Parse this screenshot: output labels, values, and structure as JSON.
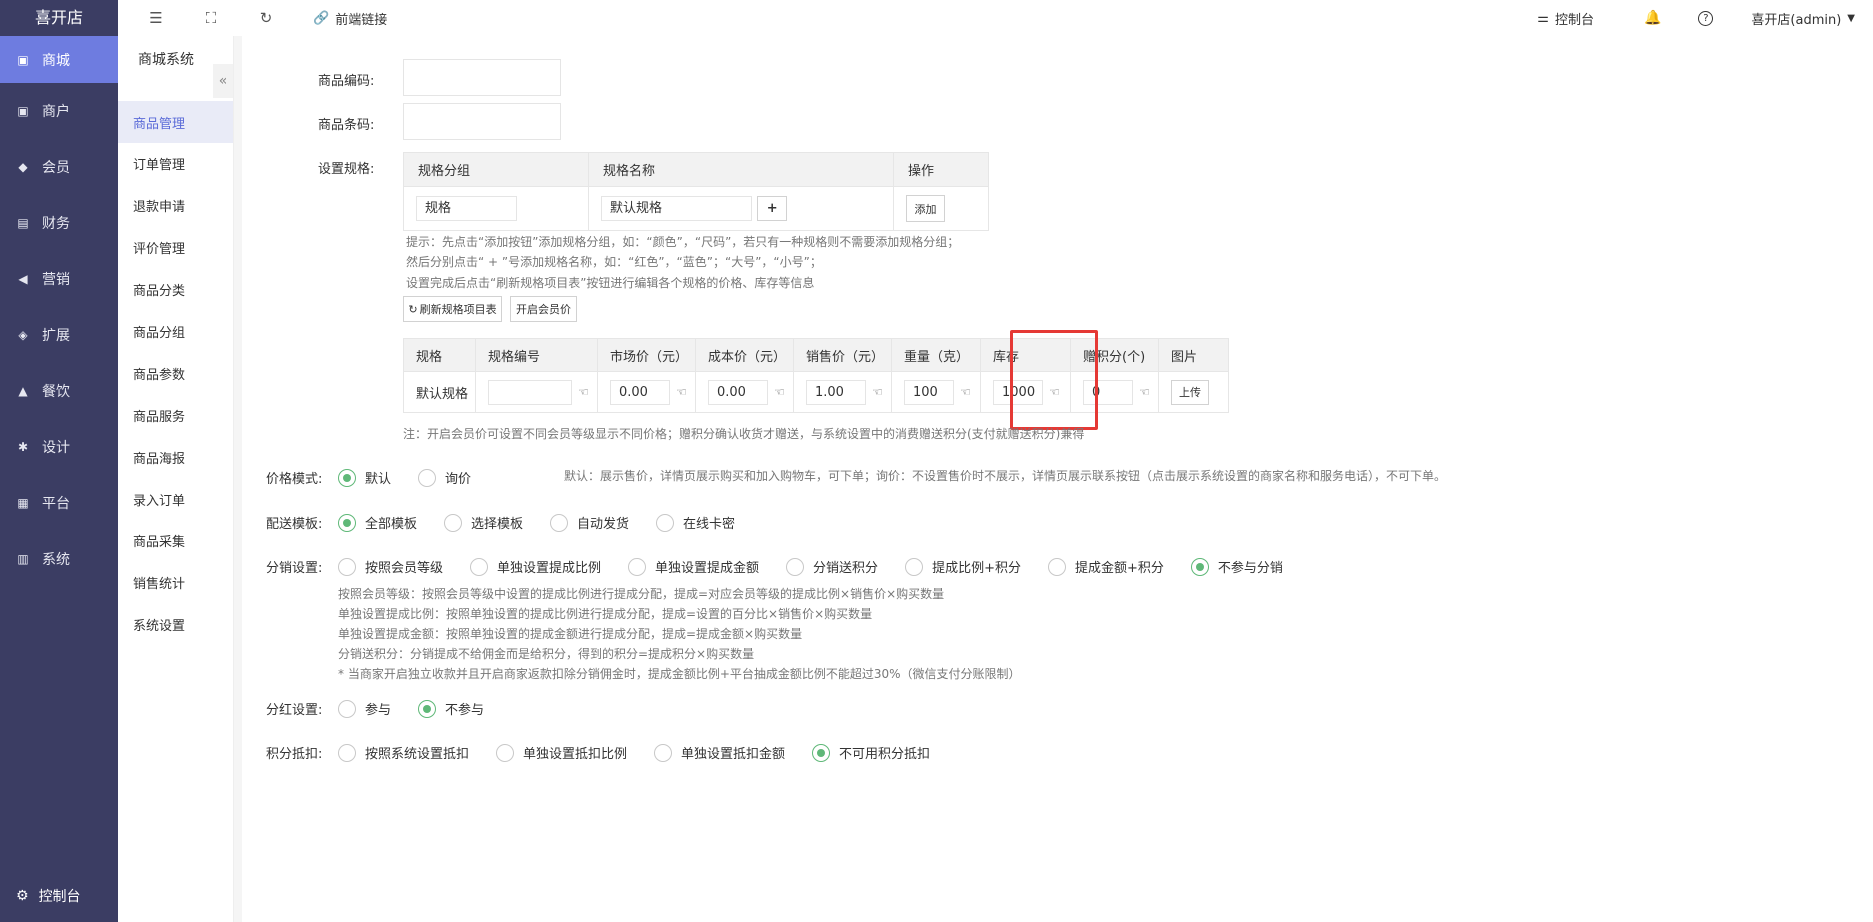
{
  "brand": "喜开店",
  "leftnav": [
    {
      "label": "商城",
      "icon": "shop-icon",
      "active": true
    },
    {
      "label": "商户",
      "icon": "merchant-icon"
    },
    {
      "label": "会员",
      "icon": "member-icon"
    },
    {
      "label": "财务",
      "icon": "finance-icon"
    },
    {
      "label": "营销",
      "icon": "marketing-icon"
    },
    {
      "label": "扩展",
      "icon": "extension-icon"
    },
    {
      "label": "餐饮",
      "icon": "dining-icon"
    },
    {
      "label": "设计",
      "icon": "design-icon"
    },
    {
      "label": "平台",
      "icon": "platform-icon"
    },
    {
      "label": "系统",
      "icon": "system-icon"
    }
  ],
  "leftnav_bottom": "控制台",
  "subnav": {
    "title": "商城系统",
    "items": [
      "商品管理",
      "订单管理",
      "退款申请",
      "评价管理",
      "商品分类",
      "商品分组",
      "商品参数",
      "商品服务",
      "商品海报",
      "录入订单",
      "商品采集",
      "销售统计",
      "系统设置"
    ]
  },
  "topbar": {
    "frontend_link": "前端链接",
    "console": "控制台",
    "user": "喜开店(admin)"
  },
  "form": {
    "code_label": "商品编码:",
    "barcode_label": "商品条码:",
    "spec_label": "设置规格:",
    "spec_table": {
      "headers": [
        "规格分组",
        "规格名称",
        "操作"
      ],
      "group_value": "规格",
      "name_value": "默认规格",
      "add_btn": "添加"
    },
    "hints": [
      "提示：先点击“添加按钮”添加规格分组，如：“颜色”，“尺码”，若只有一种规格则不需要添加规格分组；",
      "然后分别点击“ + ”号添加规格名称，如：“红色”，“蓝色”；“大号”，“小号”；",
      "设置完成后点击“刷新规格项目表”按钮进行编辑各个规格的价格、库存等信息"
    ],
    "refresh_btn": "刷新规格项目表",
    "member_price_btn": "开启会员价",
    "sku_table": {
      "headers": [
        "规格",
        "规格编号",
        "市场价（元）",
        "成本价（元）",
        "销售价（元）",
        "重量（克）",
        "库存",
        "赠积分(个)",
        "图片"
      ],
      "row": {
        "spec": "默认规格",
        "code": "",
        "market": "0.00",
        "cost": "0.00",
        "sale": "1.00",
        "weight": "100",
        "stock": "1000",
        "points": "0",
        "upload": "上传"
      }
    },
    "sku_note": "注：开启会员价可设置不同会员等级显示不同价格；赠积分确认收货才赠送，与系统设置中的消费赠送积分(支付就赠送积分)兼得",
    "price_mode": {
      "label": "价格模式:",
      "options": [
        "默认",
        "询价"
      ],
      "selected": "默认",
      "desc": "默认：展示售价，详情页展示购买和加入购物车，可下单；询价：不设置售价时不展示，详情页展示联系按钮（点击展示系统设置的商家名称和服务电话），不可下单。"
    },
    "delivery": {
      "label": "配送模板:",
      "options": [
        "全部模板",
        "选择模板",
        "自动发货",
        "在线卡密"
      ],
      "selected": "全部模板"
    },
    "distribution": {
      "label": "分销设置:",
      "options": [
        "按照会员等级",
        "单独设置提成比例",
        "单独设置提成金额",
        "分销送积分",
        "提成比例+积分",
        "提成金额+积分",
        "不参与分销"
      ],
      "selected": "不参与分销",
      "notes": [
        "按照会员等级：按照会员等级中设置的提成比例进行提成分配，提成=对应会员等级的提成比例×销售价×购买数量",
        "单独设置提成比例：按照单独设置的提成比例进行提成分配，提成=设置的百分比×销售价×购买数量",
        "单独设置提成金额：按照单独设置的提成金额进行提成分配，提成=提成金额×购买数量",
        "分销送积分：分销提成不给佣金而是给积分，得到的积分=提成积分×购买数量",
        "* 当商家开启独立收款并且开启商家返款扣除分销佣金时，提成金额比例+平台抽成金额比例不能超过30%（微信支付分账限制）"
      ]
    },
    "dividend": {
      "label": "分红设置:",
      "options": [
        "参与",
        "不参与"
      ],
      "selected": "不参与"
    },
    "points_deduct": {
      "label": "积分抵扣:",
      "options": [
        "按照系统设置抵扣",
        "单独设置抵扣比例",
        "单独设置抵扣金额",
        "不可用积分抵扣"
      ],
      "selected": "不可用积分抵扣"
    }
  },
  "colors": {
    "nav_bg": "#3b3d63",
    "nav_active": "#6e7ce0",
    "radio_on": "#5fb878",
    "highlight": "#e53935"
  }
}
